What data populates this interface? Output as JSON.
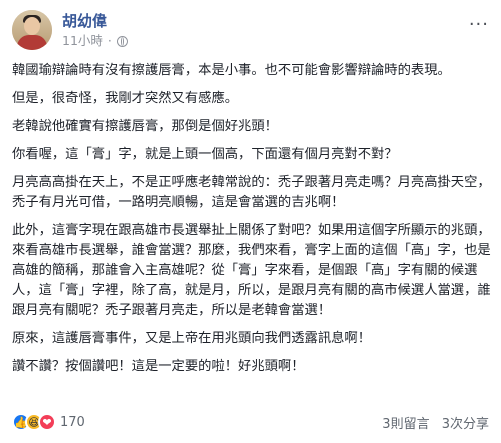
{
  "post": {
    "author": "胡幼偉",
    "time": "11小時",
    "visibility_separator": "·",
    "menu": "···"
  },
  "paragraphs": [
    "韓國瑜辯論時有沒有擦護唇膏，本是小事。也不可能會影響辯論時的表現。",
    "但是，很奇怪，我剛才突然又有感應。",
    "老韓說他確實有擦護唇膏，那倒是個好兆頭！",
    "你看喔，這「膏」字，就是上頭一個高，下面還有個月亮對不對？",
    "月亮高高掛在天上，不是正呼應老韓常說的：禿子跟著月亮走嗎？月亮高掛天空，禿子有月光可借，一路明亮順暢，這是會當選的吉兆啊！",
    "此外，這膏字現在跟高雄市長選舉扯上關係了對吧？如果用這個字所顯示的兆頭，來看高雄市長選舉，誰會當選？那麼，我們來看，膏字上面的這個「高」字，也是高雄的簡稱，那誰會入主高雄呢？從「膏」字來看，是個跟「高」字有關的候選人，這「膏」字裡，除了高，就是月，所以，是跟月亮有關的高市候選人當選，誰跟月亮有關呢？禿子跟著月亮走，所以是老韓會當選！",
    "原來，這護唇膏事件，又是上帝在用兆頭向我們透露訊息啊！",
    "讚不讚？按個讚吧！這是一定要的啦！好兆頭啊！"
  ],
  "footer": {
    "reaction_icons": [
      "like-icon",
      "haha-icon",
      "love-icon"
    ],
    "reaction_count": "170",
    "comments": "3則留言",
    "shares": "3次分享"
  }
}
